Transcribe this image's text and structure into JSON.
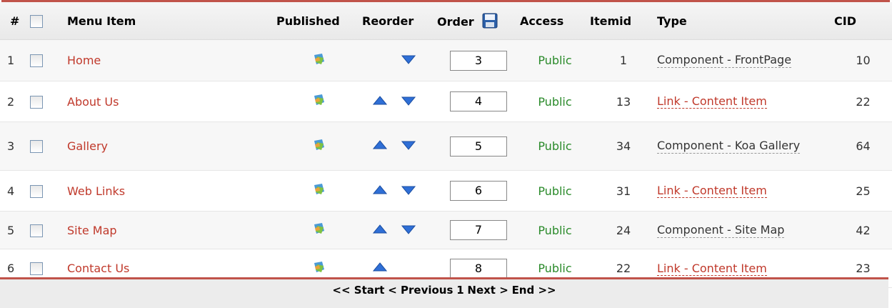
{
  "headers": {
    "num": "#",
    "menu_item": "Menu Item",
    "published": "Published",
    "reorder": "Reorder",
    "order": "Order",
    "access": "Access",
    "itemid": "Itemid",
    "type": "Type",
    "cid": "CID"
  },
  "rows": [
    {
      "num": "1",
      "name": "Home",
      "order": "3",
      "access": "Public",
      "itemid": "1",
      "type": "Component - FrontPage",
      "type_is_link": false,
      "cid": "10",
      "up": false,
      "down": true
    },
    {
      "num": "2",
      "name": "About Us",
      "order": "4",
      "access": "Public",
      "itemid": "13",
      "type": "Link - Content Item",
      "type_is_link": true,
      "cid": "22",
      "up": true,
      "down": true
    },
    {
      "num": "3",
      "name": "Gallery",
      "order": "5",
      "access": "Public",
      "itemid": "34",
      "type": "Component - Koa Gallery",
      "type_is_link": false,
      "cid": "64",
      "up": true,
      "down": true
    },
    {
      "num": "4",
      "name": "Web Links",
      "order": "6",
      "access": "Public",
      "itemid": "31",
      "type": "Link - Content Item",
      "type_is_link": true,
      "cid": "25",
      "up": true,
      "down": true
    },
    {
      "num": "5",
      "name": "Site Map",
      "order": "7",
      "access": "Public",
      "itemid": "24",
      "type": "Component - Site Map",
      "type_is_link": false,
      "cid": "42",
      "up": true,
      "down": true
    },
    {
      "num": "6",
      "name": "Contact Us",
      "order": "8",
      "access": "Public",
      "itemid": "22",
      "type": "Link - Content Item",
      "type_is_link": true,
      "cid": "23",
      "up": true,
      "down": false
    }
  ],
  "pagination": {
    "start": "<< Start",
    "prev": "< Previous",
    "page": "1",
    "next": "Next >",
    "end": "End >>"
  },
  "colors": {
    "accent": "#c0534a",
    "link": "#c0392b",
    "access": "#2a8a2a",
    "arrow": "#2f6fd6"
  }
}
